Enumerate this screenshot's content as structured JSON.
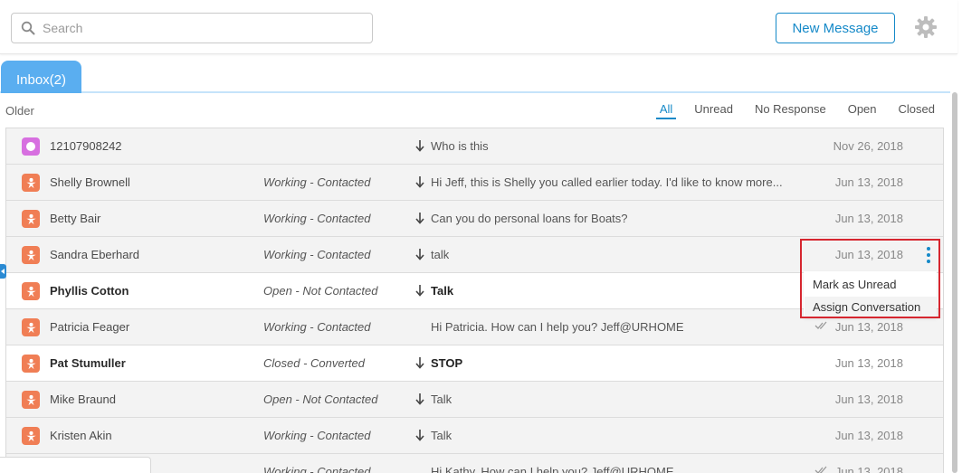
{
  "search": {
    "placeholder": "Search"
  },
  "header": {
    "new_message_label": "New Message"
  },
  "tab": {
    "label": "Inbox(2)"
  },
  "section": {
    "label": "Older"
  },
  "filters": [
    {
      "label": "All",
      "active": true
    },
    {
      "label": "Unread",
      "active": false
    },
    {
      "label": "No Response",
      "active": false
    },
    {
      "label": "Open",
      "active": false
    },
    {
      "label": "Closed",
      "active": false
    }
  ],
  "conversations": [
    {
      "name": "12107908242",
      "status": "",
      "direction": "in",
      "message": "Who is this",
      "date": "Nov 26, 2018",
      "unread": false,
      "avatar": "purple-circle",
      "read_receipt": false
    },
    {
      "name": "Shelly Brownell",
      "status": "Working - Contacted",
      "direction": "in",
      "message": "Hi Jeff, this is Shelly you called earlier today. I'd like to know more...",
      "date": "Jun 13, 2018",
      "unread": false,
      "avatar": "orange-person",
      "read_receipt": false
    },
    {
      "name": "Betty Bair",
      "status": "Working - Contacted",
      "direction": "in",
      "message": "Can you do personal loans for Boats?",
      "date": "Jun 13, 2018",
      "unread": false,
      "avatar": "orange-person",
      "read_receipt": false
    },
    {
      "name": "Sandra Eberhard",
      "status": "Working - Contacted",
      "direction": "in",
      "message": "talk",
      "date": "Jun 13, 2018",
      "unread": false,
      "avatar": "orange-person",
      "read_receipt": false
    },
    {
      "name": "Phyllis Cotton",
      "status": "Open - Not Contacted",
      "direction": "in",
      "message": "Talk",
      "date": "",
      "unread": true,
      "avatar": "orange-person",
      "read_receipt": false
    },
    {
      "name": "Patricia Feager",
      "status": "Working - Contacted",
      "direction": "out",
      "message": "Hi Patricia. How can I help you? Jeff@URHOME",
      "date": "Jun 13, 2018",
      "unread": false,
      "avatar": "orange-person",
      "read_receipt": true
    },
    {
      "name": "Pat Stumuller",
      "status": "Closed - Converted",
      "direction": "in",
      "message": "STOP",
      "date": "Jun 13, 2018",
      "unread": true,
      "avatar": "orange-person",
      "read_receipt": false
    },
    {
      "name": "Mike Braund",
      "status": "Open - Not Contacted",
      "direction": "in",
      "message": "Talk",
      "date": "Jun 13, 2018",
      "unread": false,
      "avatar": "orange-person",
      "read_receipt": false
    },
    {
      "name": "Kristen Akin",
      "status": "Working - Contacted",
      "direction": "in",
      "message": "Talk",
      "date": "Jun 13, 2018",
      "unread": false,
      "avatar": "orange-person",
      "read_receipt": false
    },
    {
      "name": "",
      "status": "Working - Contacted",
      "direction": "out",
      "message": "Hi Kathy. How can I help you? Jeff@URHOME",
      "date": "Jun 13, 2018",
      "unread": false,
      "avatar": "none",
      "read_receipt": true
    }
  ],
  "context_menu": {
    "items": [
      "Mark as Unread",
      "Assign Conversation"
    ],
    "highlight_color": "#d6262f"
  },
  "colors": {
    "accent": "#1589c8",
    "tab": "#5aaef0",
    "avatar_orange": "#f07e55",
    "avatar_purple": "#d76fe0"
  }
}
